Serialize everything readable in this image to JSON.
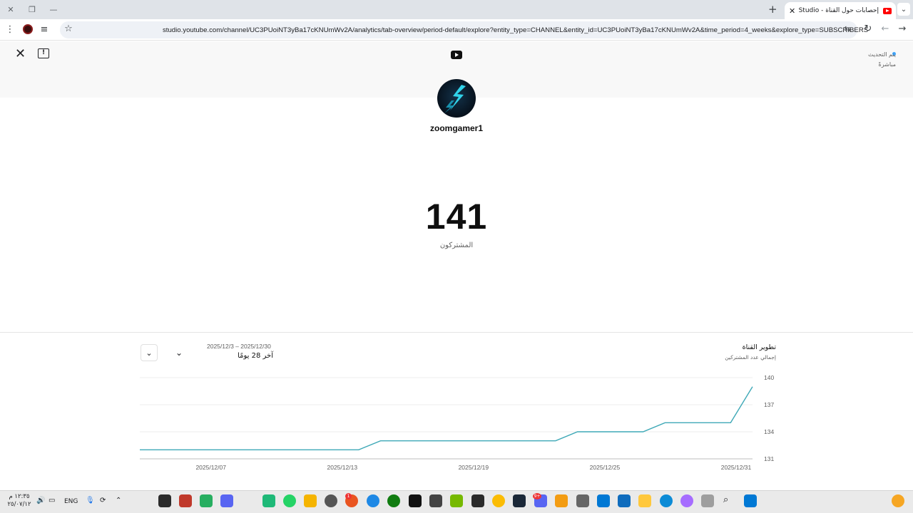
{
  "browser": {
    "tab_title": "إحصابات حول القناة - YouTube Studio",
    "url": "studio.youtube.com/channel/UC3PUoiNT3yBa17cKNUmWv2A/analytics/tab-overview/period-default/explore?entity_type=CHANNEL&entity_id=UC3PUoiNT3yBa17cKNUmWv2A&time_period=4_weeks&explore_type=SUBSCRIBERS"
  },
  "header": {
    "live_line1": "يتم التحديث",
    "live_line2": "مباشرةً"
  },
  "channel": {
    "name": "zoomgamer1",
    "subscriber_count": "141",
    "subscriber_label": "المشتركون"
  },
  "chart_section": {
    "title": "تطوير القناة",
    "subtitle": "إجمالي عدد المشتركين",
    "period_range": "2025/12/3 – 2025/12/30",
    "period_label": "آخر 28 يومًا"
  },
  "chart_data": {
    "type": "line",
    "title": "",
    "xlabel": "",
    "ylabel": "",
    "ylim": [
      131,
      140
    ],
    "y_ticks": [
      "140",
      "137",
      "134",
      "131"
    ],
    "x_tick_labels": [
      "2025/12/07",
      "2025/12/13",
      "2025/12/19",
      "2025/12/25",
      "2025/12/31"
    ],
    "x_tick_days": [
      7,
      13,
      19,
      25,
      31
    ],
    "x_range_days": [
      3,
      31
    ],
    "grid": true,
    "color": "#3fa9b7",
    "series": [
      {
        "x_days": [
          3,
          13,
          14,
          22,
          23,
          26,
          27,
          30,
          31
        ],
        "values": [
          132,
          132,
          133,
          133,
          134,
          134,
          135,
          135,
          139
        ]
      }
    ]
  },
  "taskbar": {
    "time": "١٢:٣٥ م",
    "date": "٢٥/٠٧/١٢",
    "language": "ENG",
    "discord_badge": "9+",
    "notif_badge": "1"
  }
}
